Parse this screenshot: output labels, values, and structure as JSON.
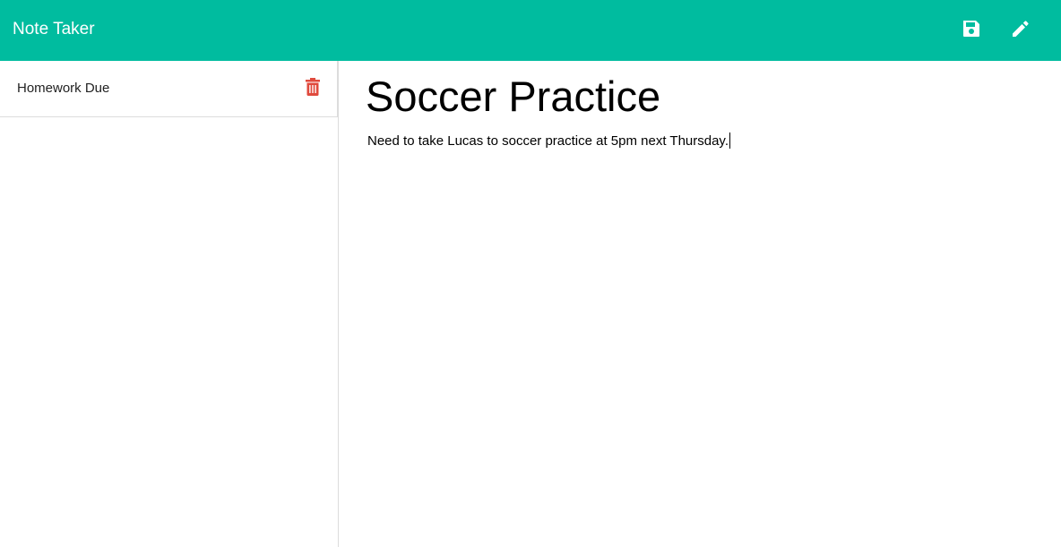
{
  "app": {
    "title": "Note Taker"
  },
  "toolbar": {
    "save_icon": "save-icon",
    "edit_icon": "pencil-icon"
  },
  "sidebar": {
    "items": [
      {
        "label": "Homework Due",
        "delete_icon": "trash-icon"
      }
    ]
  },
  "note": {
    "title": "Soccer Practice",
    "body": "Need to take Lucas to soccer practice at 5pm next Thursday."
  },
  "colors": {
    "navbar": "#00bc9f",
    "delete": "#e04a3d",
    "text": "#000000"
  }
}
